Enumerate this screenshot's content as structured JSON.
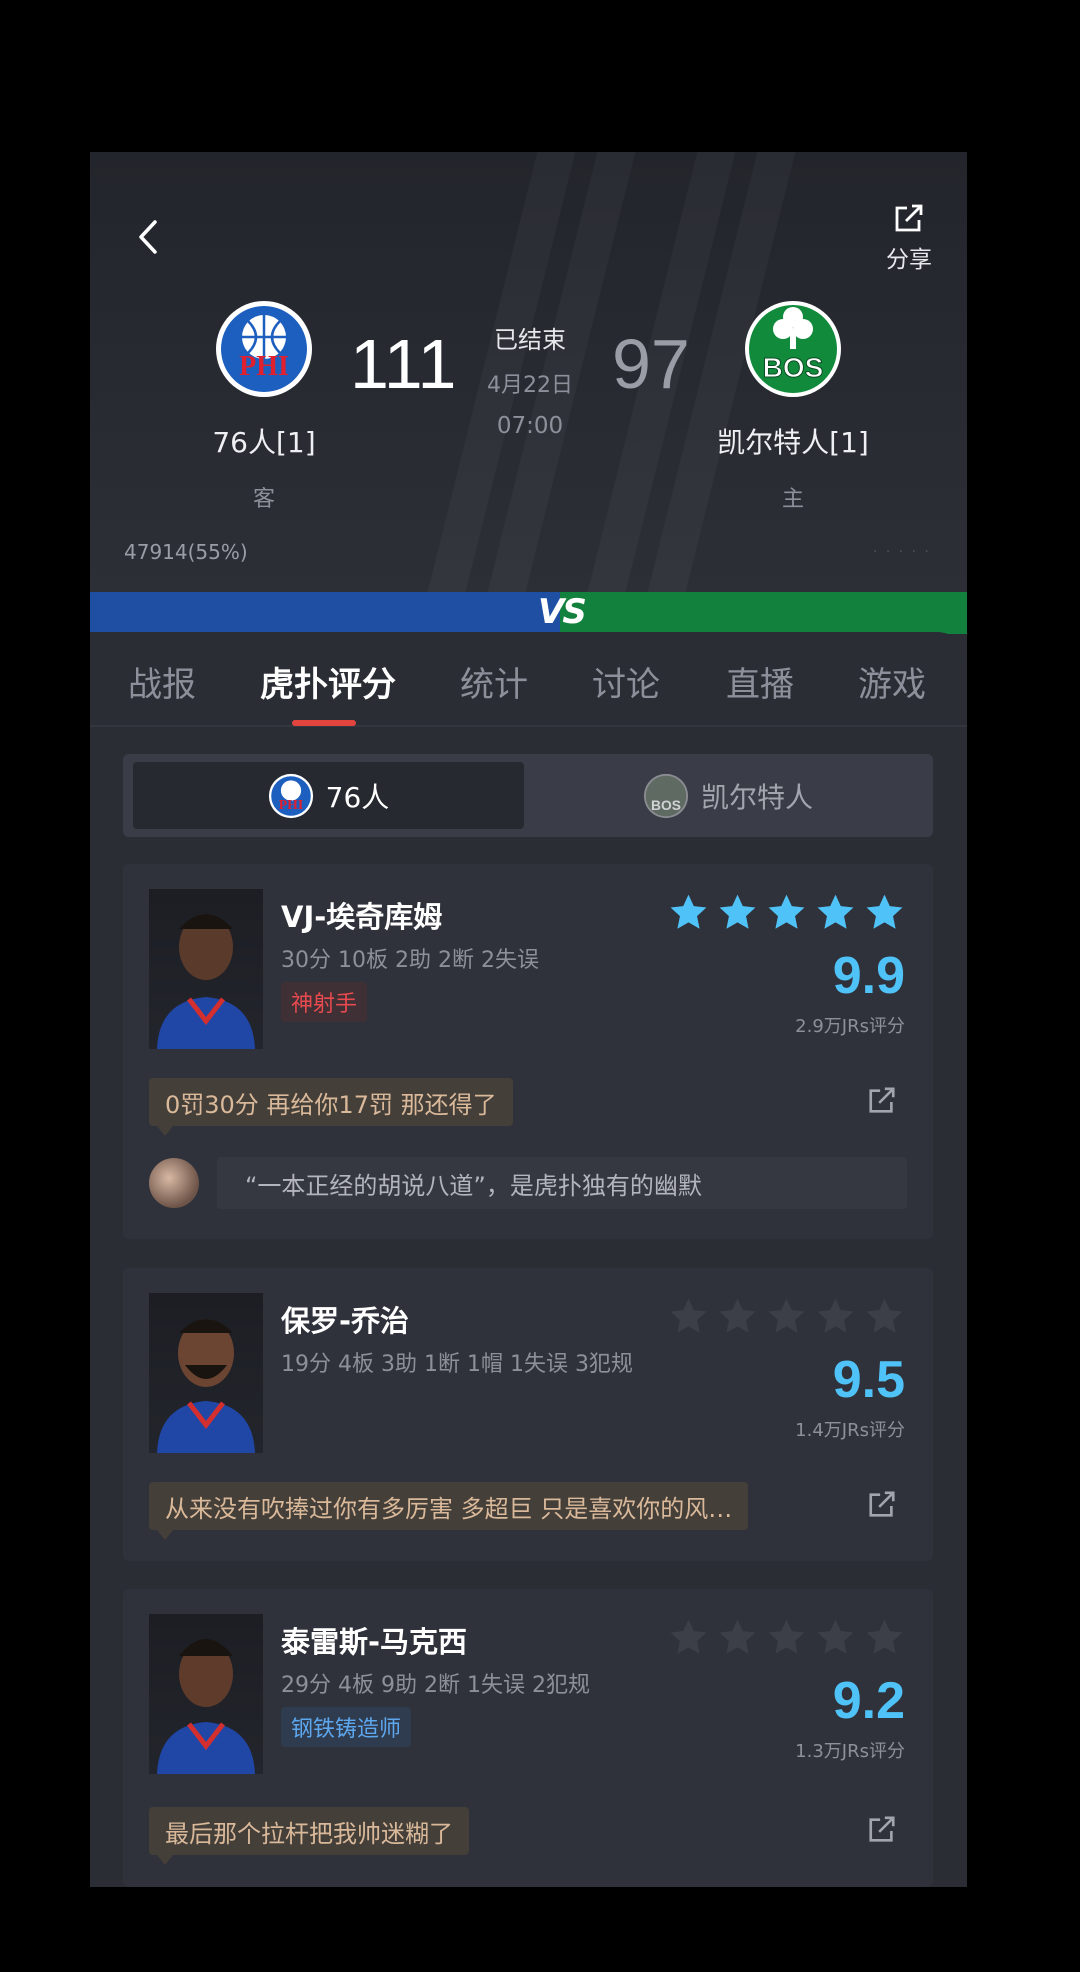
{
  "header": {
    "back_icon": "chevron-left-icon",
    "share": {
      "icon": "share-icon",
      "label": "分享"
    },
    "away": {
      "abbr": "PHI",
      "name": "76人[1]",
      "role": "客",
      "score": "111",
      "color": "#1f4fa3"
    },
    "home": {
      "abbr": "BOS",
      "name": "凯尔特人[1]",
      "role": "主",
      "score": "97",
      "color": "#13813e"
    },
    "status": {
      "state": "已结束",
      "date": "4月22日",
      "time": "07:00"
    },
    "support_left": "47914(55%)",
    "support_right": "·  ·  ·  ·  ·",
    "vs_label": "VS"
  },
  "tabs": [
    {
      "label": "战报",
      "active": false
    },
    {
      "label": "虎扑评分",
      "active": true
    },
    {
      "label": "统计",
      "active": false
    },
    {
      "label": "讨论",
      "active": false
    },
    {
      "label": "直播",
      "active": false
    },
    {
      "label": "游戏",
      "active": false
    }
  ],
  "team_switch": {
    "left": "76人",
    "right": "凯尔特人",
    "selected": "left"
  },
  "players": [
    {
      "name": "VJ-埃奇库姆",
      "stats": "30分 10板 2助 2断 2失误",
      "tag": "神射手",
      "tag_color": "red",
      "stars_filled": 5,
      "rating": "9.9",
      "jrs": "2.9万JRs评分",
      "comment": "0罚30分 再给你17罚 那还得了",
      "reply": "“一本正经的胡说八道”，是虎扑独有的幽默"
    },
    {
      "name": "保罗-乔治",
      "stats": "19分 4板 3助 1断 1帽 1失误 3犯规",
      "tag": "",
      "stars_filled": 0,
      "rating": "9.5",
      "jrs": "1.4万JRs评分",
      "comment": "从来没有吹捧过你有多厉害 多超巨 只是喜欢你的风…"
    },
    {
      "name": "泰雷斯-马克西",
      "stats": "29分 4板 9助 2断 1失误 2犯规",
      "tag": "钢铁铸造师",
      "tag_color": "blue",
      "stars_filled": 0,
      "rating": "9.2",
      "jrs": "1.3万JRs评分",
      "comment": "最后那个拉杆把我帅迷糊了"
    }
  ],
  "colors": {
    "accent_star": "#4fc3f7",
    "tab_indicator": "#e4443e",
    "comment_text": "#d9b999"
  }
}
